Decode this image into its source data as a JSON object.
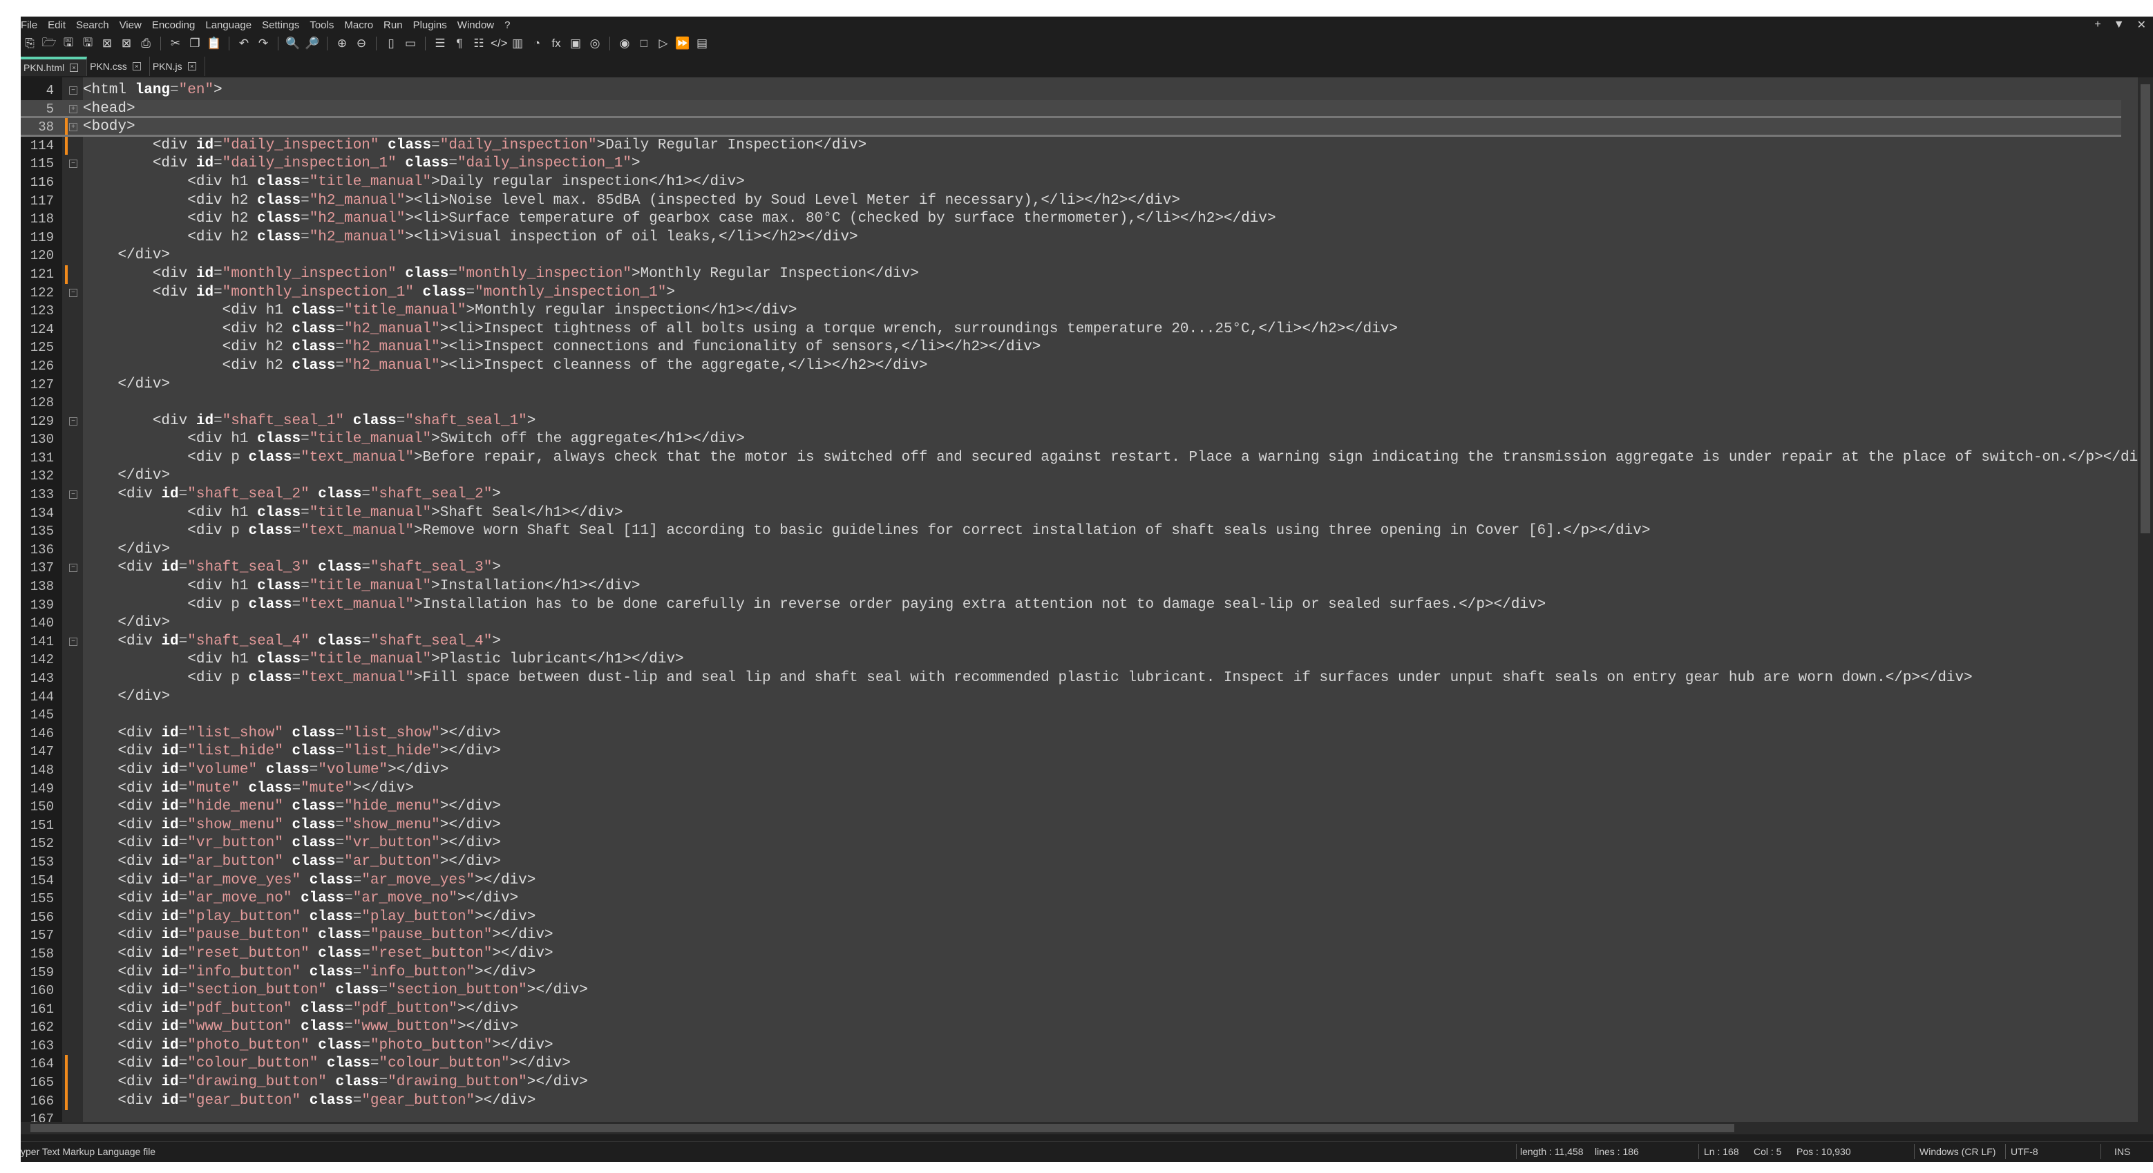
{
  "menu": [
    "File",
    "Edit",
    "Search",
    "View",
    "Encoding",
    "Language",
    "Settings",
    "Tools",
    "Macro",
    "Run",
    "Plugins",
    "Window",
    "?"
  ],
  "window_controls": [
    "+",
    "▼",
    "✕"
  ],
  "toolbar": [
    "new-file",
    "open",
    "save",
    "save-all",
    "close",
    "close-all",
    "print",
    "|",
    "cut",
    "copy",
    "paste",
    "|",
    "undo",
    "redo",
    "|",
    "find",
    "replace",
    "|",
    "zoom-in",
    "zoom-out",
    "|",
    "sync-v",
    "sync-h",
    "|",
    "word-wrap",
    "show-all-chars",
    "indent-guide",
    "udl",
    "doc-map",
    "doc-list",
    "function-list",
    "folder-workspace",
    "monitoring",
    "|",
    "record-macro",
    "stop-record",
    "play-macro",
    "run-macro-multiple",
    "save-macro"
  ],
  "toolbar_glyphs": {
    "new-file": "⎘",
    "open": "🗁",
    "save": "🖫",
    "save-all": "🖫",
    "close": "⊠",
    "close-all": "⊠",
    "print": "⎙",
    "cut": "✂",
    "copy": "❐",
    "paste": "📋",
    "undo": "↶",
    "redo": "↷",
    "find": "🔍",
    "replace": "🔎",
    "zoom-in": "⊕",
    "zoom-out": "⊖",
    "sync-v": "▯",
    "sync-h": "▭",
    "word-wrap": "☰",
    "show-all-chars": "¶",
    "indent-guide": "☷",
    "udl": "</>",
    "doc-map": "▥",
    "doc-list": "◔",
    "function-list": "fx",
    "folder-workspace": "▣",
    "monitoring": "◎",
    "record-macro": "◉",
    "stop-record": "□",
    "play-macro": "▷",
    "run-macro-multiple": "⏩",
    "save-macro": "▤"
  },
  "tabs": [
    {
      "label": "PKN.html",
      "active": true
    },
    {
      "label": "PKN.css",
      "active": false
    },
    {
      "label": "PKN.js",
      "active": false
    }
  ],
  "lines": [
    {
      "n": "4",
      "text": "<html lang=\"en\">",
      "fold": "⊟",
      "hdr": false
    },
    {
      "n": "5",
      "text": "<head>",
      "fold": "⊞",
      "hdr": true
    },
    {
      "n": "38",
      "text": "<body>",
      "fold": "⊞",
      "hdr": true,
      "chg": true
    },
    {
      "n": "114",
      "text": "        <div id=\"daily_inspection\" class=\"daily_inspection\">Daily Regular Inspection</div>",
      "chg": true
    },
    {
      "n": "115",
      "text": "        <div id=\"daily_inspection_1\" class=\"daily_inspection_1\">",
      "fold": "⊟"
    },
    {
      "n": "116",
      "text": "            <div h1 class=\"title_manual\">Daily regular inspection</h1></div>"
    },
    {
      "n": "117",
      "text": "            <div h2 class=\"h2_manual\"><li>Noise level max. 85dBA (inspected by Soud Level Meter if necessary),</li></h2></div>"
    },
    {
      "n": "118",
      "text": "            <div h2 class=\"h2_manual\"><li>Surface temperature of gearbox case max. 80°C (checked by surface thermometer),</li></h2></div>"
    },
    {
      "n": "119",
      "text": "            <div h2 class=\"h2_manual\"><li>Visual inspection of oil leaks,</li></h2></div>"
    },
    {
      "n": "120",
      "text": "    </div>"
    },
    {
      "n": "121",
      "text": "        <div id=\"monthly_inspection\" class=\"monthly_inspection\">Monthly Regular Inspection</div>",
      "chg": true
    },
    {
      "n": "122",
      "text": "        <div id=\"monthly_inspection_1\" class=\"monthly_inspection_1\">",
      "fold": "⊟"
    },
    {
      "n": "123",
      "text": "                <div h1 class=\"title_manual\">Monthly regular inspection</h1></div>"
    },
    {
      "n": "124",
      "text": "                <div h2 class=\"h2_manual\"><li>Inspect tightness of all bolts using a torque wrench, surroundings temperature 20...25°C,</li></h2></div>"
    },
    {
      "n": "125",
      "text": "                <div h2 class=\"h2_manual\"><li>Inspect connections and funcionality of sensors,</li></h2></div>"
    },
    {
      "n": "126",
      "text": "                <div h2 class=\"h2_manual\"><li>Inspect cleanness of the aggregate,</li></h2></div>"
    },
    {
      "n": "127",
      "text": "    </div>"
    },
    {
      "n": "128",
      "text": ""
    },
    {
      "n": "129",
      "text": "        <div id=\"shaft_seal_1\" class=\"shaft_seal_1\">",
      "fold": "⊟"
    },
    {
      "n": "130",
      "text": "            <div h1 class=\"title_manual\">Switch off the aggregate</h1></div>"
    },
    {
      "n": "131",
      "text": "            <div p class=\"text_manual\">Before repair, always check that the motor is switched off and secured against restart. Place a warning sign indicating the transmission aggregate is under repair at the place of switch-on.</p></div>"
    },
    {
      "n": "132",
      "text": "    </div>"
    },
    {
      "n": "133",
      "text": "    <div id=\"shaft_seal_2\" class=\"shaft_seal_2\">",
      "fold": "⊟"
    },
    {
      "n": "134",
      "text": "            <div h1 class=\"title_manual\">Shaft Seal</h1></div>"
    },
    {
      "n": "135",
      "text": "            <div p class=\"text_manual\">Remove worn Shaft Seal [11] according to basic guidelines for correct installation of shaft seals using three opening in Cover [6].</p></div>"
    },
    {
      "n": "136",
      "text": "    </div>"
    },
    {
      "n": "137",
      "text": "    <div id=\"shaft_seal_3\" class=\"shaft_seal_3\">",
      "fold": "⊟"
    },
    {
      "n": "138",
      "text": "            <div h1 class=\"title_manual\">Installation</h1></div>"
    },
    {
      "n": "139",
      "text": "            <div p class=\"text_manual\">Installation has to be done carefully in reverse order paying extra attention not to damage seal-lip or sealed surfaes.</p></div>"
    },
    {
      "n": "140",
      "text": "    </div>"
    },
    {
      "n": "141",
      "text": "    <div id=\"shaft_seal_4\" class=\"shaft_seal_4\">",
      "fold": "⊟"
    },
    {
      "n": "142",
      "text": "            <div h1 class=\"title_manual\">Plastic lubricant</h1></div>"
    },
    {
      "n": "143",
      "text": "            <div p class=\"text_manual\">Fill space between dust-lip and seal lip and shaft seal with recommended plastic lubricant. Inspect if surfaces under unput shaft seals on entry gear hub are worn down.</p></div>"
    },
    {
      "n": "144",
      "text": "    </div>"
    },
    {
      "n": "145",
      "text": ""
    },
    {
      "n": "146",
      "text": "    <div id=\"list_show\" class=\"list_show\"></div>"
    },
    {
      "n": "147",
      "text": "    <div id=\"list_hide\" class=\"list_hide\"></div>"
    },
    {
      "n": "148",
      "text": "    <div id=\"volume\" class=\"volume\"></div>"
    },
    {
      "n": "149",
      "text": "    <div id=\"mute\" class=\"mute\"></div>"
    },
    {
      "n": "150",
      "text": "    <div id=\"hide_menu\" class=\"hide_menu\"></div>"
    },
    {
      "n": "151",
      "text": "    <div id=\"show_menu\" class=\"show_menu\"></div>"
    },
    {
      "n": "152",
      "text": "    <div id=\"vr_button\" class=\"vr_button\"></div>"
    },
    {
      "n": "153",
      "text": "    <div id=\"ar_button\" class=\"ar_button\"></div>"
    },
    {
      "n": "154",
      "text": "    <div id=\"ar_move_yes\" class=\"ar_move_yes\"></div>"
    },
    {
      "n": "155",
      "text": "    <div id=\"ar_move_no\" class=\"ar_move_no\"></div>"
    },
    {
      "n": "156",
      "text": "    <div id=\"play_button\" class=\"play_button\"></div>"
    },
    {
      "n": "157",
      "text": "    <div id=\"pause_button\" class=\"pause_button\"></div>"
    },
    {
      "n": "158",
      "text": "    <div id=\"reset_button\" class=\"reset_button\"></div>"
    },
    {
      "n": "159",
      "text": "    <div id=\"info_button\" class=\"info_button\"></div>"
    },
    {
      "n": "160",
      "text": "    <div id=\"section_button\" class=\"section_button\"></div>"
    },
    {
      "n": "161",
      "text": "    <div id=\"pdf_button\" class=\"pdf_button\"></div>"
    },
    {
      "n": "162",
      "text": "    <div id=\"www_button\" class=\"www_button\"></div>"
    },
    {
      "n": "163",
      "text": "    <div id=\"photo_button\" class=\"photo_button\"></div>"
    },
    {
      "n": "164",
      "text": "    <div id=\"colour_button\" class=\"colour_button\"></div>",
      "chg": true
    },
    {
      "n": "165",
      "text": "    <div id=\"drawing_button\" class=\"drawing_button\"></div>",
      "chg": true
    },
    {
      "n": "166",
      "text": "    <div id=\"gear_button\" class=\"gear_button\"></div>",
      "chg": true
    },
    {
      "n": "167",
      "text": ""
    }
  ],
  "status": {
    "file_type": "yper Text Markup Language file",
    "length": "length : 11,458",
    "lines": "lines : 186",
    "ln": "Ln : 168",
    "col": "Col : 5",
    "pos": "Pos : 10,930",
    "eol": "Windows (CR LF)",
    "encoding": "UTF-8",
    "mode": "INS"
  },
  "colors": {
    "editor_bg": "#3f3f3f",
    "string": "#e39a9a",
    "change_marker": "#f08a1c",
    "active_tab": "#5fd3b0"
  }
}
